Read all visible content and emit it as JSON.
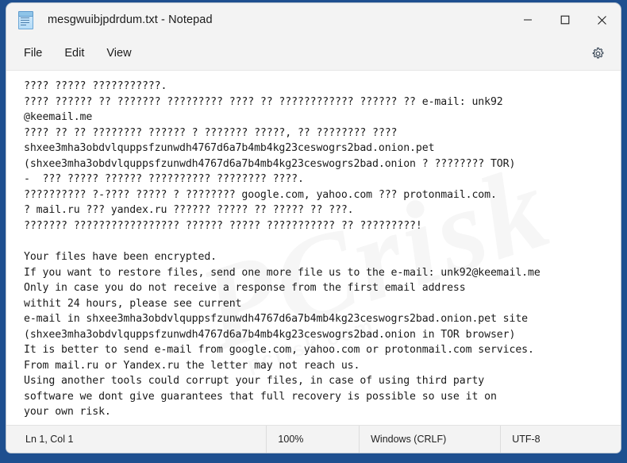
{
  "window": {
    "title": "mesgwuibjpdrdum.txt - Notepad",
    "app_icon": "notepad-icon",
    "controls": {
      "minimize": "minimize-icon",
      "maximize": "maximize-icon",
      "close": "close-icon"
    }
  },
  "menubar": {
    "items": [
      {
        "label": "File",
        "name": "menu-item-file"
      },
      {
        "label": "Edit",
        "name": "menu-item-edit"
      },
      {
        "label": "View",
        "name": "menu-item-view"
      }
    ],
    "settings_icon": "gear-icon"
  },
  "editor": {
    "content": "???? ????? ???????????.\n???? ?????? ?? ??????? ????????? ???? ?? ???????????? ?????? ?? e-mail: unk92\n@keemail.me\n???? ?? ?? ???????? ?????? ? ??????? ?????, ?? ???????? ????\nshxee3mha3obdvlquppsfzunwdh4767d6a7b4mb4kg23ceswogrs2bad.onion.pet\n(shxee3mha3obdvlquppsfzunwdh4767d6a7b4mb4kg23ceswogrs2bad.onion ? ???????? TOR)\n-  ??? ????? ?????? ?????????? ???????? ????.\n?????????? ?-???? ????? ? ???????? google.com, yahoo.com ??? protonmail.com.\n? mail.ru ??? yandex.ru ?????? ????? ?? ????? ?? ???.\n??????? ????????????????? ?????? ????? ??????????? ?? ?????????!\n\nYour files have been encrypted.\nIf you want to restore files, send one more file us to the e-mail: unk92@keemail.me\nOnly in case you do not receive a response from the first email address\nwithit 24 hours, please see current\ne-mail in shxee3mha3obdvlquppsfzunwdh4767d6a7b4mb4kg23ceswogrs2bad.onion.pet site\n(shxee3mha3obdvlquppsfzunwdh4767d6a7b4mb4kg23ceswogrs2bad.onion in TOR browser)\nIt is better to send e-mail from google.com, yahoo.com or protonmail.com services.\nFrom mail.ru or Yandex.ru the letter may not reach us.\nUsing another tools could corrupt your files, in case of using third party\nsoftware we dont give guarantees that full recovery is possible so use it on\nyour own risk.",
    "watermark": "PCrisk",
    "watermark_sub": "pcrisk.com"
  },
  "statusbar": {
    "cursor_position": "Ln 1, Col 1",
    "zoom": "100%",
    "line_ending": "Windows (CRLF)",
    "encoding": "UTF-8"
  },
  "colors": {
    "window_chrome": "#f3f3f3",
    "desktop": "#1e4f8f",
    "text": "#1a1a1a",
    "editor_background": "#ffffff"
  }
}
